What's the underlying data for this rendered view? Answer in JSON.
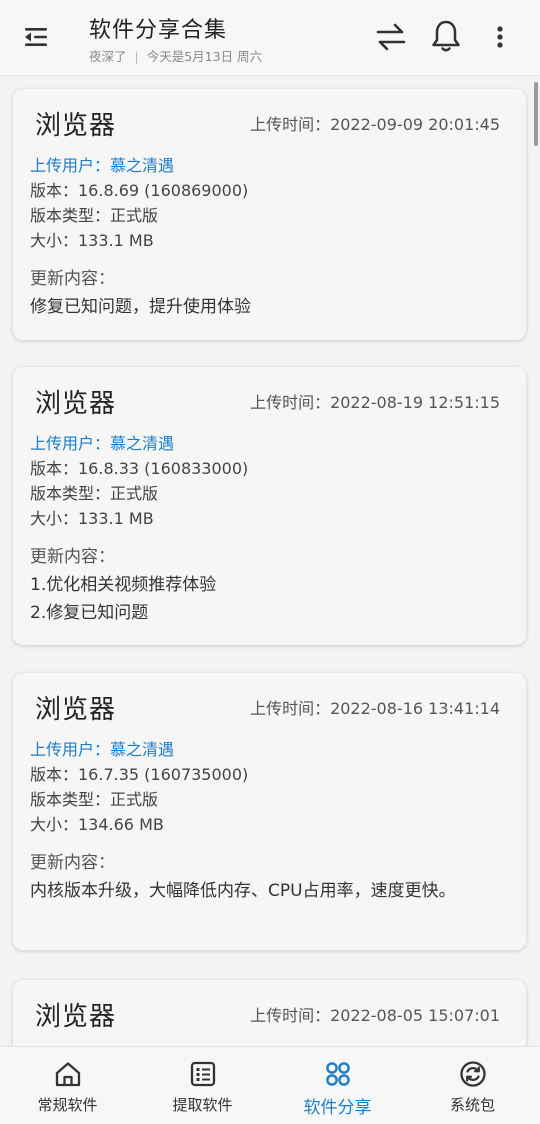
{
  "header": {
    "title": "软件分享合集",
    "subtitle_left": "夜深了",
    "subtitle_sep": "|",
    "subtitle_right": "今天是5月13日 周六",
    "icons": [
      "menu-collapse-icon",
      "swap-icon",
      "bell-icon",
      "more-vertical-icon"
    ]
  },
  "cards": [
    {
      "name": "浏览器",
      "upload_time": "上传时间：2022-09-09 20:01:45",
      "user": "上传用户：慕之清遇",
      "version": "版本：16.8.69 (160869000)",
      "type": "版本类型：正式版",
      "size": "大小：133.1 MB",
      "update_label": "更新内容：",
      "changelog": [
        "修复已知问题，提升使用体验"
      ]
    },
    {
      "name": "浏览器",
      "upload_time": "上传时间：2022-08-19 12:51:15",
      "user": "上传用户：慕之清遇",
      "version": "版本：16.8.33 (160833000)",
      "type": "版本类型：正式版",
      "size": "大小：133.1 MB",
      "update_label": "更新内容：",
      "changelog": [
        "1.优化相关视频推荐体验",
        "2.修复已知问题"
      ]
    },
    {
      "name": "浏览器",
      "upload_time": "上传时间：2022-08-16 13:41:14",
      "user": "上传用户：慕之清遇",
      "version": "版本：16.7.35 (160735000)",
      "type": "版本类型：正式版",
      "size": "大小：134.66 MB",
      "update_label": "更新内容：",
      "changelog": [
        "内核版本升级，大幅降低内存、CPU占用率，速度更快。"
      ]
    },
    {
      "name": "浏览器",
      "upload_time": "上传时间：2022-08-05 15:07:01"
    }
  ],
  "bottom_nav": [
    {
      "label": "常规软件",
      "icon": "home-icon"
    },
    {
      "label": "提取软件",
      "icon": "list-box-icon"
    },
    {
      "label": "软件分享",
      "icon": "grid-circles-icon",
      "active": true
    },
    {
      "label": "系统包",
      "icon": "refresh-circle-icon"
    }
  ],
  "colors": {
    "accent": "#1d7cc8",
    "background": "#f3f3f3",
    "card": "#f6f6f6"
  }
}
